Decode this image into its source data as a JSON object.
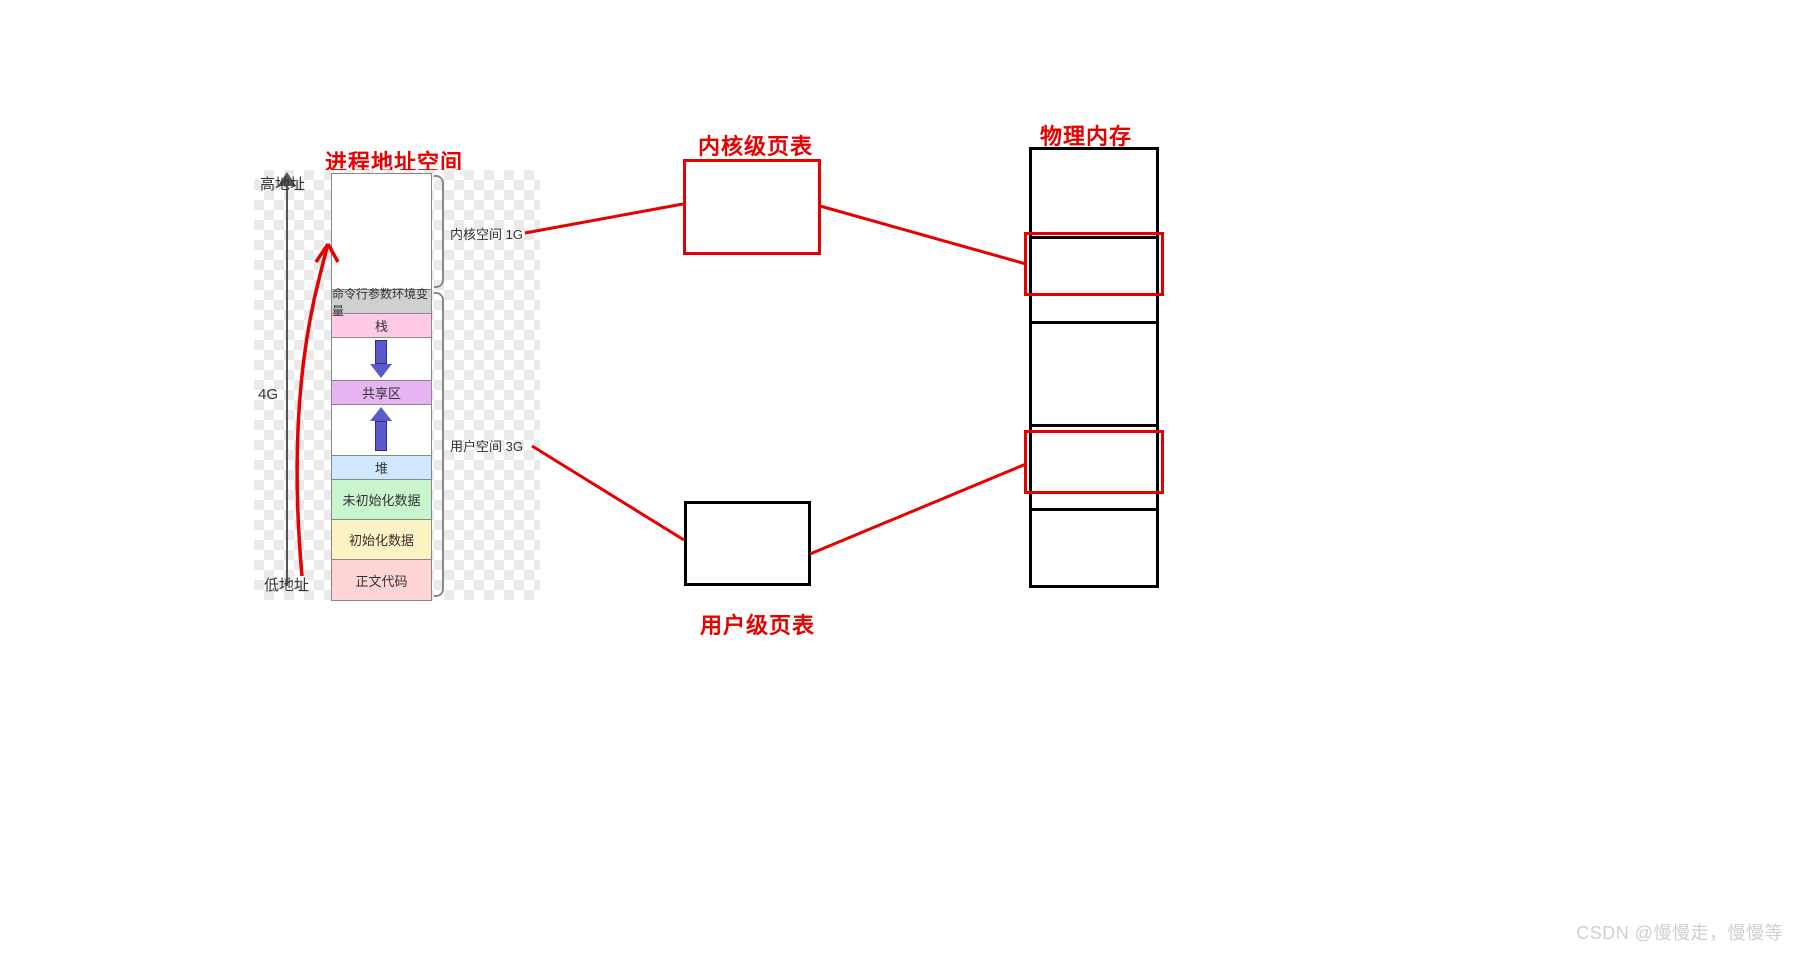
{
  "titles": {
    "vspace": "进程地址空间",
    "kernel_pt": "内核级页表",
    "user_pt": "用户级页表",
    "phys_mem": "物理内存"
  },
  "axis": {
    "high": "高地址",
    "low": "低地址",
    "total": "4G"
  },
  "segments": {
    "env": "命令行参数环境变量",
    "stack": "栈",
    "shared": "共享区",
    "heap": "堆",
    "bss": "未初始化数据",
    "data": "初始化数据",
    "text": "正文代码"
  },
  "braces": {
    "kernel": "内核空间 1G",
    "user": "用户空间 3G"
  },
  "watermark": "CSDN @慢慢走，慢慢等"
}
